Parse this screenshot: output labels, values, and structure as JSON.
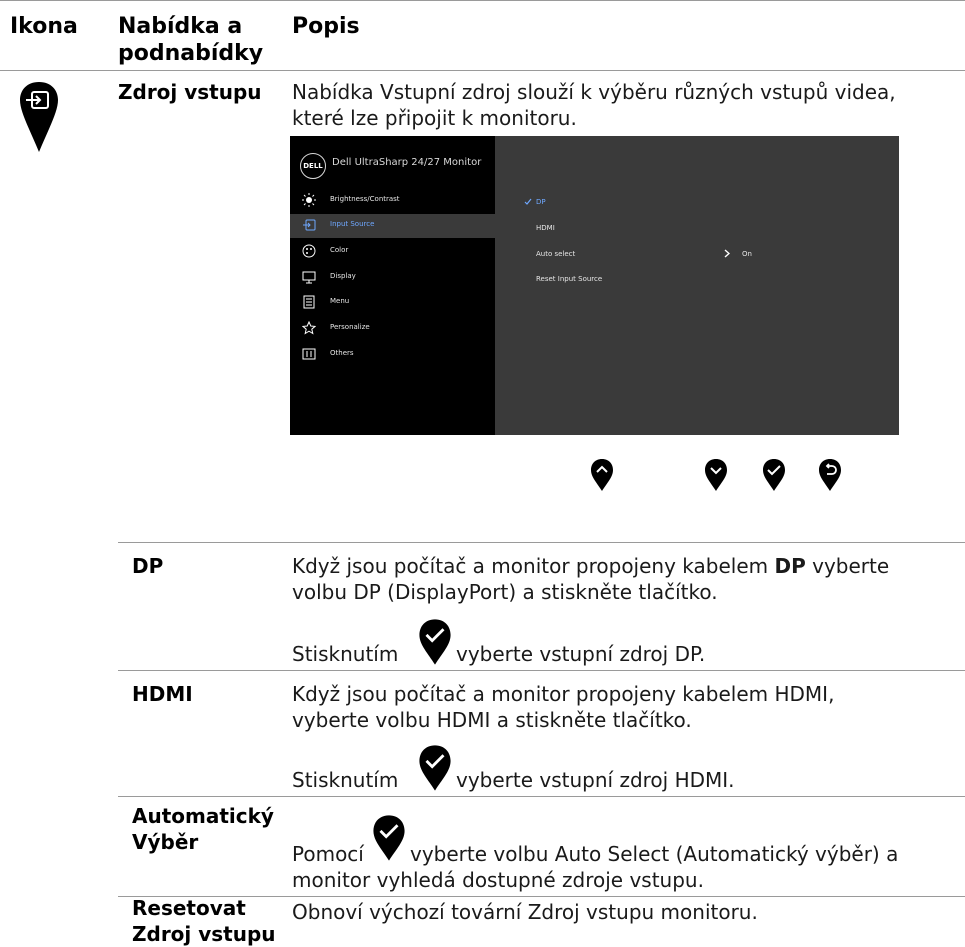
{
  "header": {
    "col_icon": "Ikona",
    "col_menu_1": "Nabídka a",
    "col_menu_2": "podnabídky",
    "col_desc": "Popis"
  },
  "section": {
    "name": "Zdroj vstupu",
    "description_1": "Nabídka Vstupní zdroj slouží k výběru různých vstupů videa,",
    "description_2": "které lze připojit k monitoru."
  },
  "osd": {
    "title": "Dell UltraSharp 24/27 Monitor",
    "logo": "DELL",
    "menu": [
      {
        "label": "Brightness/Contrast",
        "icon": "brightness-icon"
      },
      {
        "label": "Input Source",
        "icon": "input-source-icon",
        "active": true
      },
      {
        "label": "Color",
        "icon": "color-palette-icon"
      },
      {
        "label": "Display",
        "icon": "display-icon"
      },
      {
        "label": "Menu",
        "icon": "menu-icon"
      },
      {
        "label": "Personalize",
        "icon": "star-icon"
      },
      {
        "label": "Others",
        "icon": "others-icon"
      }
    ],
    "options": {
      "dp": "DP",
      "hdmi": "HDMI",
      "auto_select": "Auto select",
      "auto_select_value": "On",
      "reset": "Reset Input Source"
    },
    "accent_color": "#6fa8ff",
    "nav_buttons": [
      "up-button-icon",
      "down-button-icon",
      "check-button-icon",
      "back-button-icon"
    ]
  },
  "rows": {
    "dp": {
      "label": "DP",
      "line1_pre": "Když jsou počítač a monitor propojeny kabelem ",
      "line1_bold": "DP",
      "line1_post": " vyberte",
      "line2": "volbu DP (DisplayPort) a stiskněte tlačítko.",
      "press_pre": "Stisknutím",
      "press_post": "vyberte vstupní zdroj DP."
    },
    "hdmi": {
      "label": "HDMI",
      "line1": "Když jsou počítač a monitor propojeny kabelem HDMI,",
      "line2": "vyberte volbu HDMI a stiskněte tlačítko.",
      "press_pre": "Stisknutím",
      "press_post": "vyberte vstupní zdroj HDMI."
    },
    "auto": {
      "label_1": "Automatický",
      "label_2": "Výběr",
      "line1_pre": "Pomocí",
      "line1_post": "vyberte volbu Auto Select (Automatický výběr) a",
      "line2": "monitor vyhledá dostupné zdroje vstupu."
    },
    "reset": {
      "label_1": "Resetovat",
      "label_2": "Zdroj vstupu",
      "line1": "Obnoví výchozí tovární Zdroj vstupu monitoru."
    }
  }
}
